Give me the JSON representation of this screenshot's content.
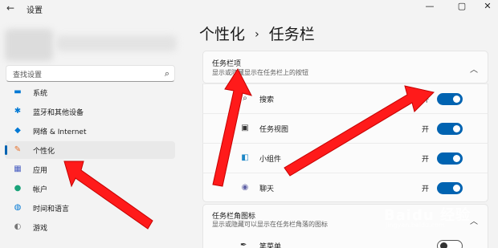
{
  "window": {
    "back_icon": "back-arrow-icon",
    "title": "设置",
    "controls": [
      "—",
      "▢",
      "✕"
    ]
  },
  "search": {
    "placeholder": "查找设置"
  },
  "sidebar": {
    "items": [
      {
        "label": "系统",
        "icon": "monitor-icon",
        "color": "#0078d4",
        "glyph": "▬"
      },
      {
        "label": "蓝牙和其他设备",
        "icon": "bluetooth-icon",
        "color": "#0078d4",
        "glyph": "✱"
      },
      {
        "label": "网络 & Internet",
        "icon": "wifi-icon",
        "color": "#0078d4",
        "glyph": "◆"
      },
      {
        "label": "个性化",
        "icon": "brush-icon",
        "color": "#e8702a",
        "glyph": "✎",
        "active": true
      },
      {
        "label": "应用",
        "icon": "apps-icon",
        "color": "#4a5fc1",
        "glyph": "▦"
      },
      {
        "label": "帐户",
        "icon": "account-icon",
        "color": "#1aa37a",
        "glyph": "●"
      },
      {
        "label": "时间和语言",
        "icon": "globe-clock-icon",
        "color": "#0078d4",
        "glyph": "◍"
      },
      {
        "label": "游戏",
        "icon": "gamepad-icon",
        "color": "#777777",
        "glyph": "◐"
      }
    ]
  },
  "main": {
    "breadcrumb_parent": "个性化",
    "breadcrumb_sep": "›",
    "breadcrumb_current": "任务栏"
  },
  "taskbar_items": {
    "title": "任务栏项",
    "subtitle": "显示或隐藏显示在任务栏上的按钮",
    "rows": [
      {
        "label": "搜索",
        "state": "开",
        "on": true,
        "icon": "search-icon",
        "glyph": "⌕",
        "color": "#333333"
      },
      {
        "label": "任务视图",
        "state": "开",
        "on": true,
        "icon": "task-view-icon",
        "glyph": "▣",
        "color": "#333333"
      },
      {
        "label": "小组件",
        "state": "开",
        "on": true,
        "icon": "widgets-icon",
        "glyph": "◧",
        "color": "#1e88c7"
      },
      {
        "label": "聊天",
        "state": "开",
        "on": true,
        "icon": "chat-icon",
        "glyph": "◉",
        "color": "#6264a7"
      }
    ]
  },
  "corner_icons": {
    "title": "任务栏角图标",
    "subtitle": "显示或隐藏可以显示在任务栏角落的图标",
    "rows": [
      {
        "label": "笔菜单",
        "on": false,
        "icon": "pen-icon",
        "glyph": "✒",
        "color": "#333333"
      }
    ]
  },
  "watermark": {
    "text": "Baidu 经验",
    "sub": "jingyan.baidu.com"
  },
  "accent_color": "#0063b1",
  "annotation_color": "#ff0000"
}
